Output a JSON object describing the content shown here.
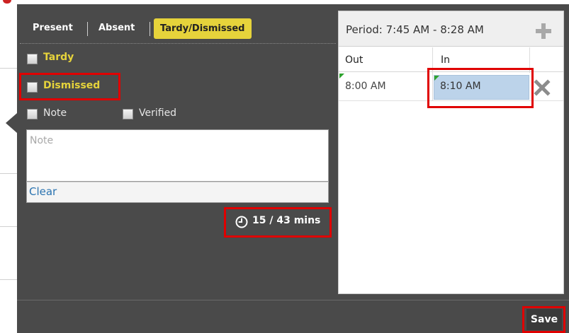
{
  "tabs": {
    "present": "Present",
    "absent": "Absent",
    "tardy_dismissed": "Tardy/Dismissed"
  },
  "checkboxes": {
    "tardy": "Tardy",
    "dismissed": "Dismissed",
    "note": "Note",
    "verified": "Verified"
  },
  "note": {
    "placeholder": "Note",
    "clear_label": "Clear"
  },
  "timer": {
    "text": "15 / 43 mins"
  },
  "period": {
    "title": "Period: 7:45 AM - 8:28 AM",
    "columns": {
      "out": "Out",
      "in": "In"
    },
    "rows": [
      {
        "out": "8:00 AM",
        "in": "8:10 AM"
      }
    ]
  },
  "footer": {
    "save_label": "Save"
  },
  "colors": {
    "accent_yellow": "#e6d33b",
    "popup_bg": "#4a4a4a",
    "highlight_red": "#e00000",
    "selected_cell": "#bcd3ea"
  }
}
